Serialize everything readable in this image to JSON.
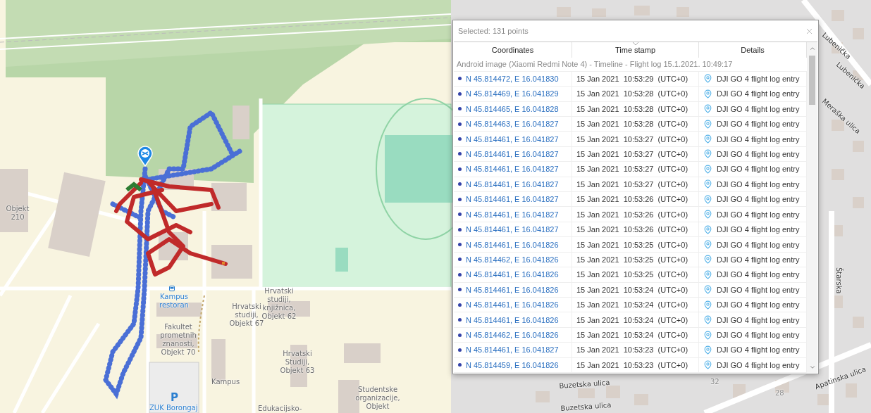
{
  "map": {
    "labels": [
      {
        "text": "Objekt 210",
        "kind": "place"
      },
      {
        "text": "Kampus restoran",
        "kind": "poi"
      },
      {
        "text": "Fakultet prometnih znanosti, Objekt 70",
        "kind": "place"
      },
      {
        "text": "Hrvatski studiji, Objekt 67",
        "kind": "place"
      },
      {
        "text": "Hrvatski studiji, knjižnica, Objekt 62",
        "kind": "place"
      },
      {
        "text": "Hrvatski Studiji, Objekt 63",
        "kind": "place"
      },
      {
        "text": "Kampus",
        "kind": "place"
      },
      {
        "text": "ZUK Borongaj",
        "kind": "poi"
      },
      {
        "text": "Edukacijsko-",
        "kind": "place"
      },
      {
        "text": "Studentske organizacije, Objekt",
        "kind": "place"
      },
      {
        "text": "Buzetska ulica",
        "kind": "street"
      },
      {
        "text": "Buzetska ulica",
        "kind": "street"
      },
      {
        "text": "32",
        "kind": "number"
      },
      {
        "text": "28",
        "kind": "number"
      },
      {
        "text": "Apatinska ulica",
        "kind": "street"
      },
      {
        "text": "Lubenička",
        "kind": "street"
      },
      {
        "text": "Lubenička",
        "kind": "street"
      },
      {
        "text": "Meraška ulica",
        "kind": "street"
      },
      {
        "text": "Štarska",
        "kind": "street"
      }
    ],
    "parking": {
      "text": "P"
    }
  },
  "popup": {
    "title": "Selected: 131 points",
    "columns": [
      {
        "label": "Coordinates",
        "sorted": false
      },
      {
        "label": "Time stamp",
        "sorted": true
      },
      {
        "label": "Details",
        "sorted": false
      }
    ],
    "group": "Android image (Xiaomi Redmi Note 4) - Timeline - Flight log 15.1.2021. 10:49:17",
    "rows": [
      {
        "coordinates": "N 45.814472, E 16.041830",
        "time": "15 Jan 2021  10:53:29  (UTC+0)",
        "details": "DJI GO 4 flight log entry"
      },
      {
        "coordinates": "N 45.814469, E 16.041829",
        "time": "15 Jan 2021  10:53:28  (UTC+0)",
        "details": "DJI GO 4 flight log entry"
      },
      {
        "coordinates": "N 45.814465, E 16.041828",
        "time": "15 Jan 2021  10:53:28  (UTC+0)",
        "details": "DJI GO 4 flight log entry"
      },
      {
        "coordinates": "N 45.814463, E 16.041827",
        "time": "15 Jan 2021  10:53:28  (UTC+0)",
        "details": "DJI GO 4 flight log entry"
      },
      {
        "coordinates": "N 45.814461, E 16.041827",
        "time": "15 Jan 2021  10:53:27  (UTC+0)",
        "details": "DJI GO 4 flight log entry"
      },
      {
        "coordinates": "N 45.814461, E 16.041827",
        "time": "15 Jan 2021  10:53:27  (UTC+0)",
        "details": "DJI GO 4 flight log entry"
      },
      {
        "coordinates": "N 45.814461, E 16.041827",
        "time": "15 Jan 2021  10:53:27  (UTC+0)",
        "details": "DJI GO 4 flight log entry"
      },
      {
        "coordinates": "N 45.814461, E 16.041827",
        "time": "15 Jan 2021  10:53:27  (UTC+0)",
        "details": "DJI GO 4 flight log entry"
      },
      {
        "coordinates": "N 45.814461, E 16.041827",
        "time": "15 Jan 2021  10:53:26  (UTC+0)",
        "details": "DJI GO 4 flight log entry"
      },
      {
        "coordinates": "N 45.814461, E 16.041827",
        "time": "15 Jan 2021  10:53:26  (UTC+0)",
        "details": "DJI GO 4 flight log entry"
      },
      {
        "coordinates": "N 45.814461, E 16.041827",
        "time": "15 Jan 2021  10:53:26  (UTC+0)",
        "details": "DJI GO 4 flight log entry"
      },
      {
        "coordinates": "N 45.814461, E 16.041826",
        "time": "15 Jan 2021  10:53:25  (UTC+0)",
        "details": "DJI GO 4 flight log entry"
      },
      {
        "coordinates": "N 45.814462, E 16.041826",
        "time": "15 Jan 2021  10:53:25  (UTC+0)",
        "details": "DJI GO 4 flight log entry"
      },
      {
        "coordinates": "N 45.814461, E 16.041826",
        "time": "15 Jan 2021  10:53:25  (UTC+0)",
        "details": "DJI GO 4 flight log entry"
      },
      {
        "coordinates": "N 45.814461, E 16.041826",
        "time": "15 Jan 2021  10:53:24  (UTC+0)",
        "details": "DJI GO 4 flight log entry"
      },
      {
        "coordinates": "N 45.814461, E 16.041826",
        "time": "15 Jan 2021  10:53:24  (UTC+0)",
        "details": "DJI GO 4 flight log entry"
      },
      {
        "coordinates": "N 45.814461, E 16.041826",
        "time": "15 Jan 2021  10:53:24  (UTC+0)",
        "details": "DJI GO 4 flight log entry"
      },
      {
        "coordinates": "N 45.814462, E 16.041826",
        "time": "15 Jan 2021  10:53:24  (UTC+0)",
        "details": "DJI GO 4 flight log entry"
      },
      {
        "coordinates": "N 45.814461, E 16.041827",
        "time": "15 Jan 2021  10:53:23  (UTC+0)",
        "details": "DJI GO 4 flight log entry"
      },
      {
        "coordinates": "N 45.814459, E 16.041826",
        "time": "15 Jan 2021  10:53:23  (UTC+0)",
        "details": "DJI GO 4 flight log entry"
      }
    ]
  }
}
